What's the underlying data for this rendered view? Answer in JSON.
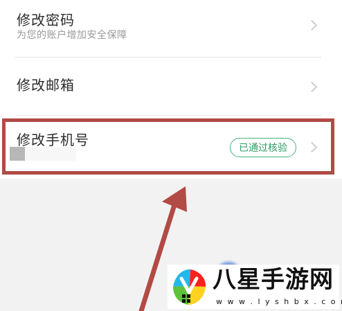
{
  "settings": {
    "items": [
      {
        "title": "修改密码",
        "subtitle": "为您的账户增加安全保障"
      },
      {
        "title": "修改邮箱"
      },
      {
        "title": "修改手机号",
        "status": "已通过核验"
      }
    ]
  },
  "watermark": {
    "title": "八星手游网",
    "url": "w w w . l y s h b x . c o m"
  },
  "icons": {
    "chevron": "chevron-right-icon",
    "annotation": "annotation-arrow-icon",
    "logo": "watermark-logo-icon"
  },
  "colors": {
    "highlight": "#b24a45",
    "verified": "#47b27d"
  }
}
